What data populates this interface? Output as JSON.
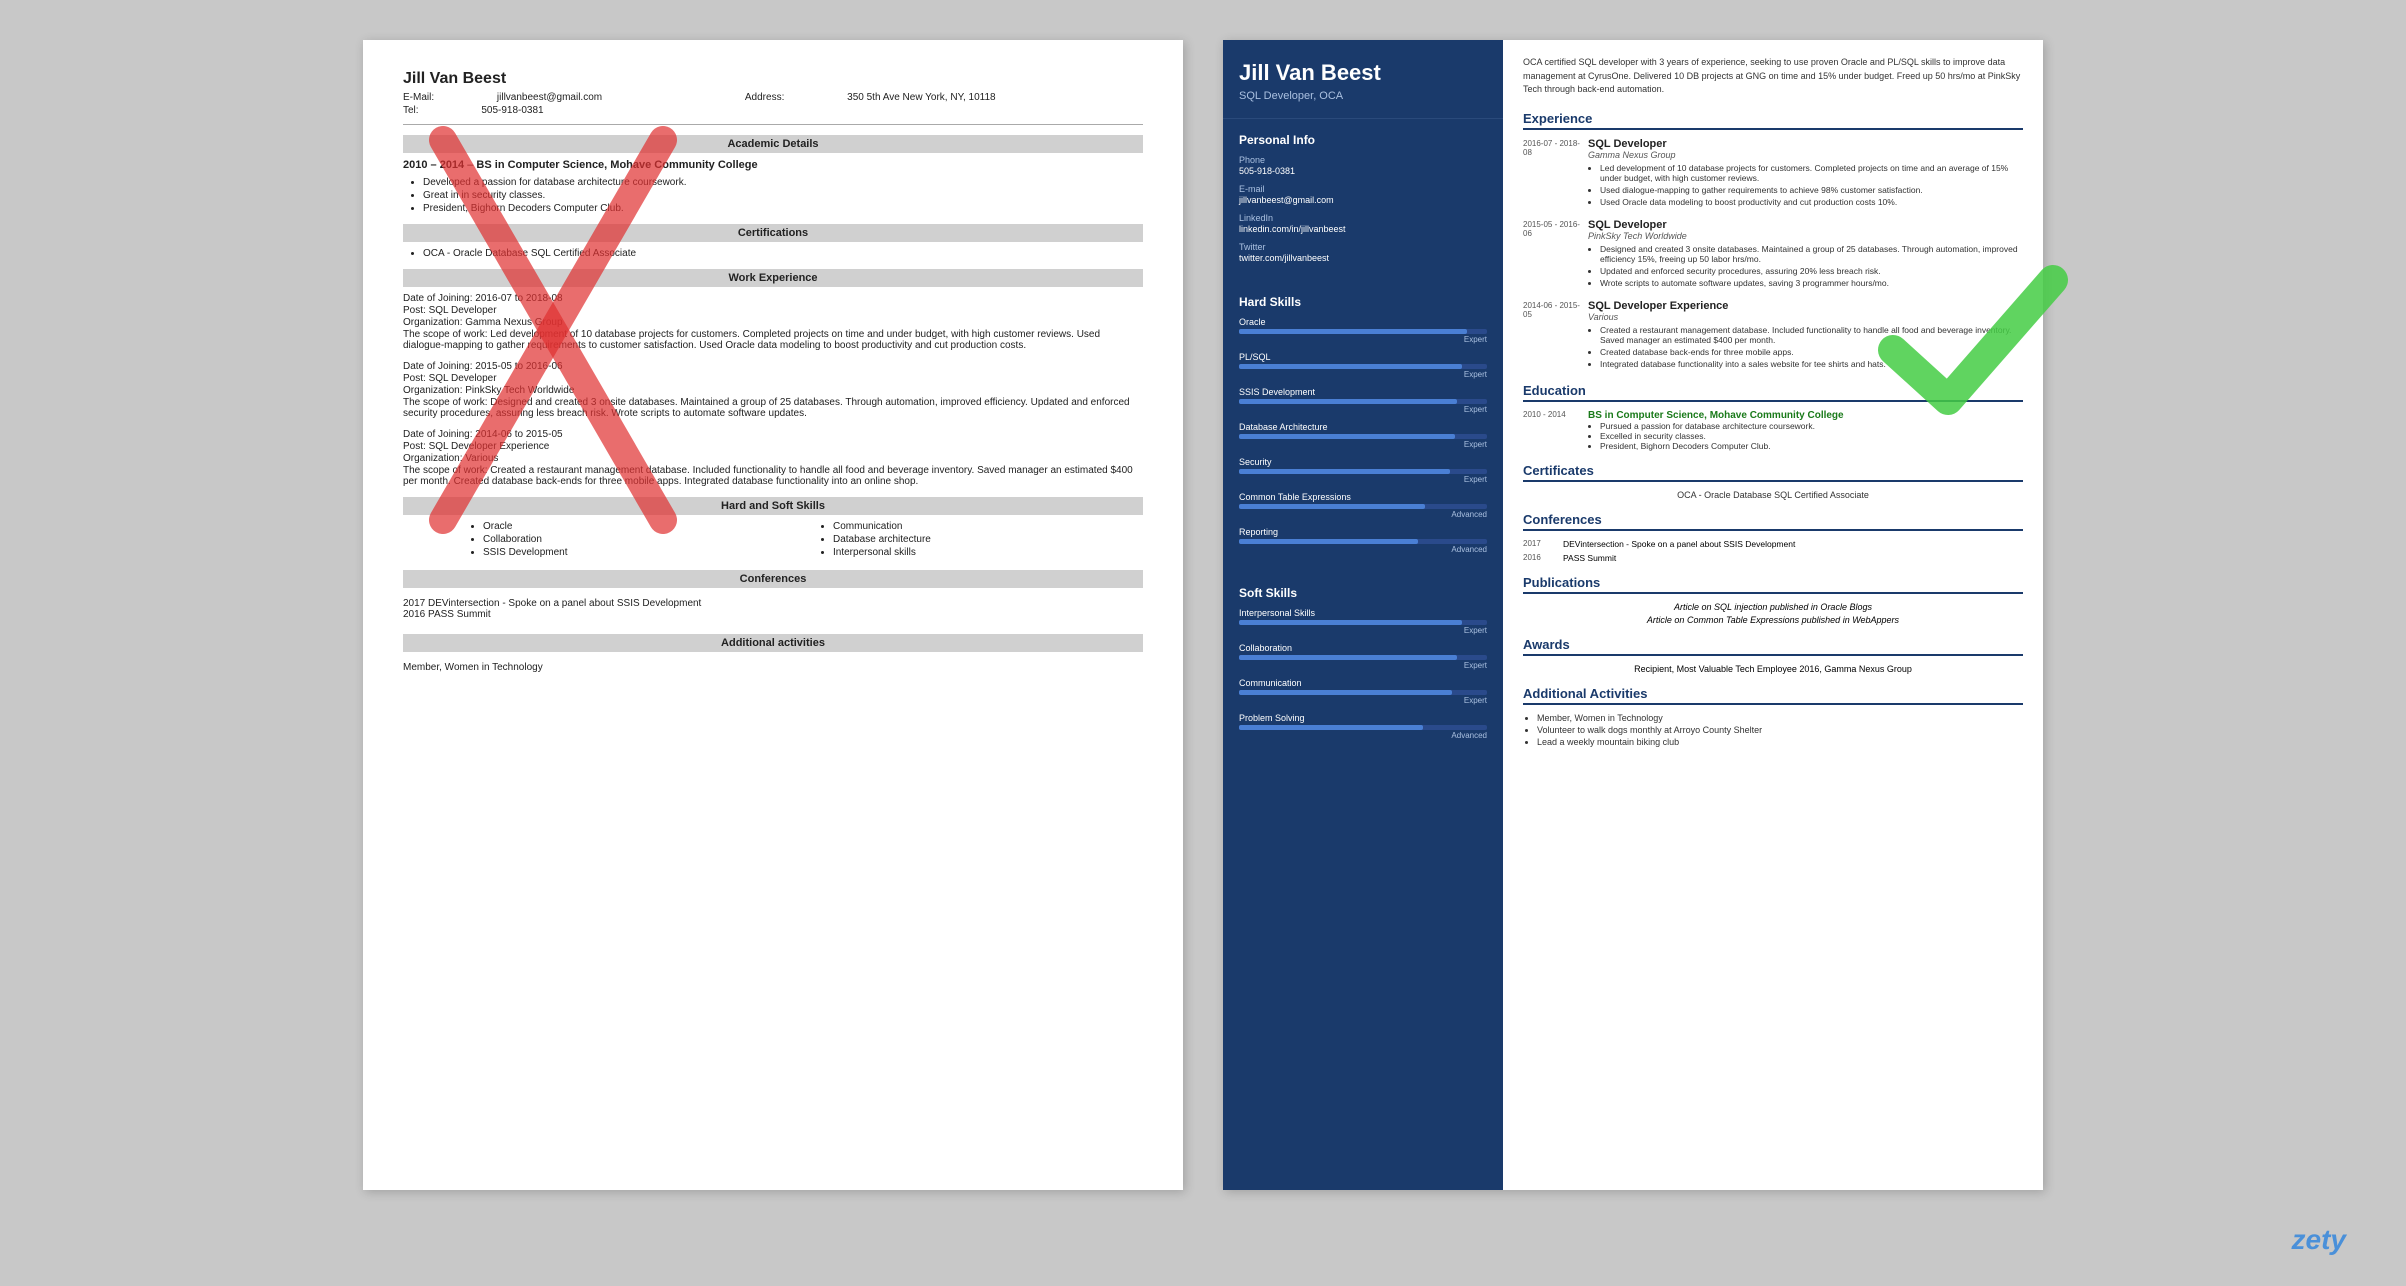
{
  "left": {
    "name": "Jill Van Beest",
    "email_label": "E-Mail:",
    "email": "jillvanbeest@gmail.com",
    "address_label": "Address:",
    "address": "350 5th Ave New York, NY, 10118",
    "tel_label": "Tel:",
    "tel": "505-918-0381",
    "sections": {
      "academic": "Academic Details",
      "certifications": "Certifications",
      "work": "Work Experience",
      "skills": "Hard and Soft Skills",
      "conferences": "Conferences",
      "additional": "Additional activities"
    },
    "education": {
      "dates": "2010 – 2014",
      "degree": "BS in Computer Science, Mohave Community College",
      "bullets": [
        "Developed a passion for database architecture coursework.",
        "Great in in security classes.",
        "President, Bighorn Decoders Computer Club."
      ]
    },
    "certifications": [
      "OCA - Oracle Database SQL Certified Associate"
    ],
    "work": [
      {
        "dates": "Date of Joining: 2016-07 to 2018-08",
        "post": "Post: SQL Developer",
        "org": "Organization: Gamma Nexus Group",
        "scope": "The scope of work: Led development of 10 database projects for customers. Completed projects on time and under budget, with high customer reviews. Used dialogue-mapping to gather requirements to customer satisfaction. Used Oracle data modeling to boost productivity and cut production costs."
      },
      {
        "dates": "Date of Joining: 2015-05 to 2016-06",
        "post": "Post: SQL Developer",
        "org": "Organization: PinkSky Tech Worldwide",
        "scope": "The scope of work: Designed and created 3 onsite databases. Maintained a group of 25 databases. Through automation, improved efficiency. Updated and enforced security procedures, assuring less breach risk. Wrote scripts to automate software updates."
      },
      {
        "dates": "Date of Joining: 2014-06 to 2015-05",
        "post": "Post: SQL Developer Experience",
        "org": "Organization: Various",
        "scope": "The scope of work: Created a restaurant management database. Included functionality to handle all food and beverage inventory. Saved manager an estimated $400 per month. Created database back-ends for three mobile apps. Integrated database functionality into an online shop."
      }
    ],
    "skills": [
      "Oracle",
      "Collaboration",
      "SSIS Development",
      "Communication",
      "Database architecture",
      "Interpersonal skills"
    ],
    "conferences_list": [
      "2017 DEVintersection - Spoke on a panel about SSIS Development",
      "2016 PASS Summit"
    ],
    "additional_list": [
      "Member, Women in Technology"
    ]
  },
  "right": {
    "name": "Jill Van Beest",
    "title": "SQL Developer, OCA",
    "summary": "OCA certified SQL developer with 3 years of experience, seeking to use proven Oracle and PL/SQL skills to improve data management at CyrusOne. Delivered 10 DB projects at GNG on time and 15% under budget. Freed up 50 hrs/mo at PinkSky Tech through back-end automation.",
    "personal_info": {
      "section_title": "Personal Info",
      "phone_label": "Phone",
      "phone": "505-918-0381",
      "email_label": "E-mail",
      "email": "jillvanbeest@gmail.com",
      "linkedin_label": "LinkedIn",
      "linkedin": "linkedin.com/in/jillvanbeest",
      "twitter_label": "Twitter",
      "twitter": "twitter.com/jillvanbeest"
    },
    "hard_skills": {
      "section_title": "Hard Skills",
      "skills": [
        {
          "name": "Oracle",
          "level": "Expert",
          "pct": 92
        },
        {
          "name": "PL/SQL",
          "level": "Expert",
          "pct": 90
        },
        {
          "name": "SSIS Development",
          "level": "Expert",
          "pct": 88
        },
        {
          "name": "Database Architecture",
          "level": "Expert",
          "pct": 87
        },
        {
          "name": "Security",
          "level": "Expert",
          "pct": 85
        },
        {
          "name": "Common Table Expressions",
          "level": "Advanced",
          "pct": 75
        },
        {
          "name": "Reporting",
          "level": "Advanced",
          "pct": 72
        }
      ]
    },
    "soft_skills": {
      "section_title": "Soft Skills",
      "skills": [
        {
          "name": "Interpersonal Skills",
          "level": "Expert",
          "pct": 90
        },
        {
          "name": "Collaboration",
          "level": "Expert",
          "pct": 88
        },
        {
          "name": "Communication",
          "level": "Expert",
          "pct": 86
        },
        {
          "name": "Problem Solving",
          "level": "Advanced",
          "pct": 74
        }
      ]
    },
    "experience": {
      "section_title": "Experience",
      "entries": [
        {
          "dates": "2016-07 - 2018-08",
          "title": "SQL Developer",
          "company": "Gamma Nexus Group",
          "bullets": [
            "Led development of 10 database projects for customers. Completed projects on time and an average of 15% under budget, with high customer reviews.",
            "Used dialogue-mapping to gather requirements to achieve 98% customer satisfaction.",
            "Used Oracle data modeling to boost productivity and cut production costs 10%."
          ]
        },
        {
          "dates": "2015-05 - 2016-06",
          "title": "SQL Developer",
          "company": "PinkSky Tech Worldwide",
          "bullets": [
            "Designed and created 3 onsite databases. Maintained a group of 25 databases. Through automation, improved efficiency 15%, freeing up 50 labor hrs/mo.",
            "Updated and enforced security procedures, assuring 20% less breach risk.",
            "Wrote scripts to automate software updates, saving 3 programmer hours/mo."
          ]
        },
        {
          "dates": "2014-06 - 2015-05",
          "title": "SQL Developer Experience",
          "company": "Various",
          "bullets": [
            "Created a restaurant management database. Included functionality to handle all food and beverage inventory. Saved manager an estimated $400 per month.",
            "Created database back-ends for three mobile apps.",
            "Integrated database functionality into a sales website for tee shirts and hats."
          ]
        }
      ]
    },
    "education": {
      "section_title": "Education",
      "entries": [
        {
          "dates": "2010 - 2014",
          "degree": "BS in Computer Science, Mohave Community College",
          "bullets": [
            "Pursued a passion for database architecture coursework.",
            "Excelled in security classes.",
            "President, Bighorn Decoders Computer Club."
          ]
        }
      ]
    },
    "certificates": {
      "section_title": "Certificates",
      "list": [
        "OCA - Oracle Database SQL Certified Associate"
      ]
    },
    "conferences": {
      "section_title": "Conferences",
      "entries": [
        {
          "year": "2017",
          "desc": "DEVintersection - Spoke on a panel about SSIS Development"
        },
        {
          "year": "2016",
          "desc": "PASS Summit"
        }
      ]
    },
    "publications": {
      "section_title": "Publications",
      "list": [
        "Article on SQL injection published in Oracle Blogs",
        "Article on Common Table Expressions published in WebAppers"
      ]
    },
    "awards": {
      "section_title": "Awards",
      "list": [
        "Recipient, Most Valuable Tech Employee 2016, Gamma Nexus Group"
      ]
    },
    "additional": {
      "section_title": "Additional Activities",
      "list": [
        "Member, Women in Technology",
        "Volunteer to walk dogs monthly at Arroyo County Shelter",
        "Lead a weekly mountain biking club"
      ]
    }
  },
  "watermark": "zety"
}
